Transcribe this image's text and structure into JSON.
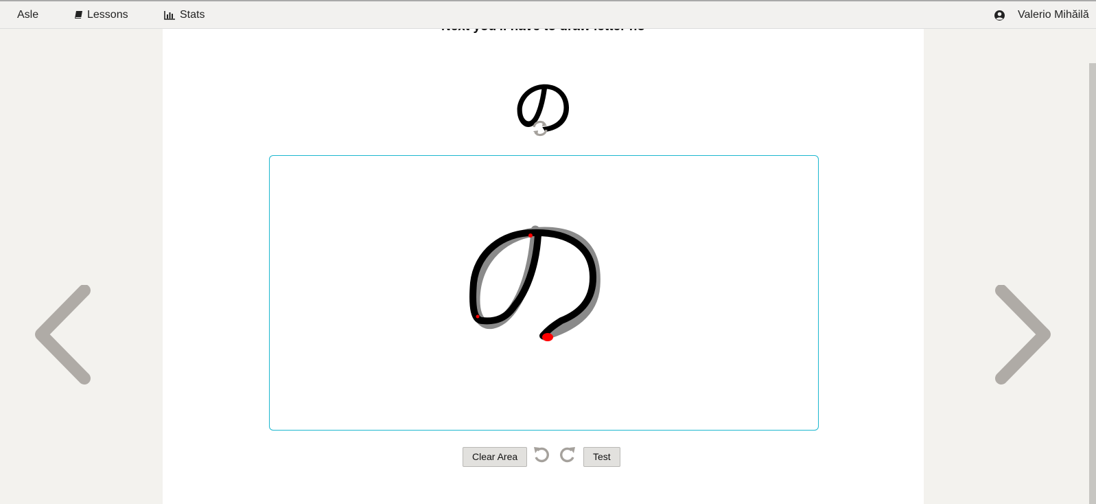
{
  "navbar": {
    "brand": "Asle",
    "lessons_label": "Lessons",
    "stats_label": "Stats",
    "user_name": "Valerio Mihăilă",
    "icons": {
      "lessons": "book-icon",
      "stats": "bar-chart-icon",
      "user": "user-circle-icon"
    }
  },
  "exercise": {
    "heading": "Next you'll have to draw letter no",
    "sample_character": "の",
    "canvas_border_color": "#1bb7cf",
    "stroke_color": "#000000",
    "guide_color": "#8a8a8a",
    "error_marker_color": "#ff0000"
  },
  "controls": {
    "clear_label": "Clear Area",
    "test_label": "Test",
    "icons": {
      "refresh": "refresh-icon",
      "undo": "undo-icon",
      "redo": "redo-icon"
    }
  },
  "navigation": {
    "prev": "chevron-left-icon",
    "next": "chevron-right-icon",
    "arrow_color": "#afaba6"
  }
}
